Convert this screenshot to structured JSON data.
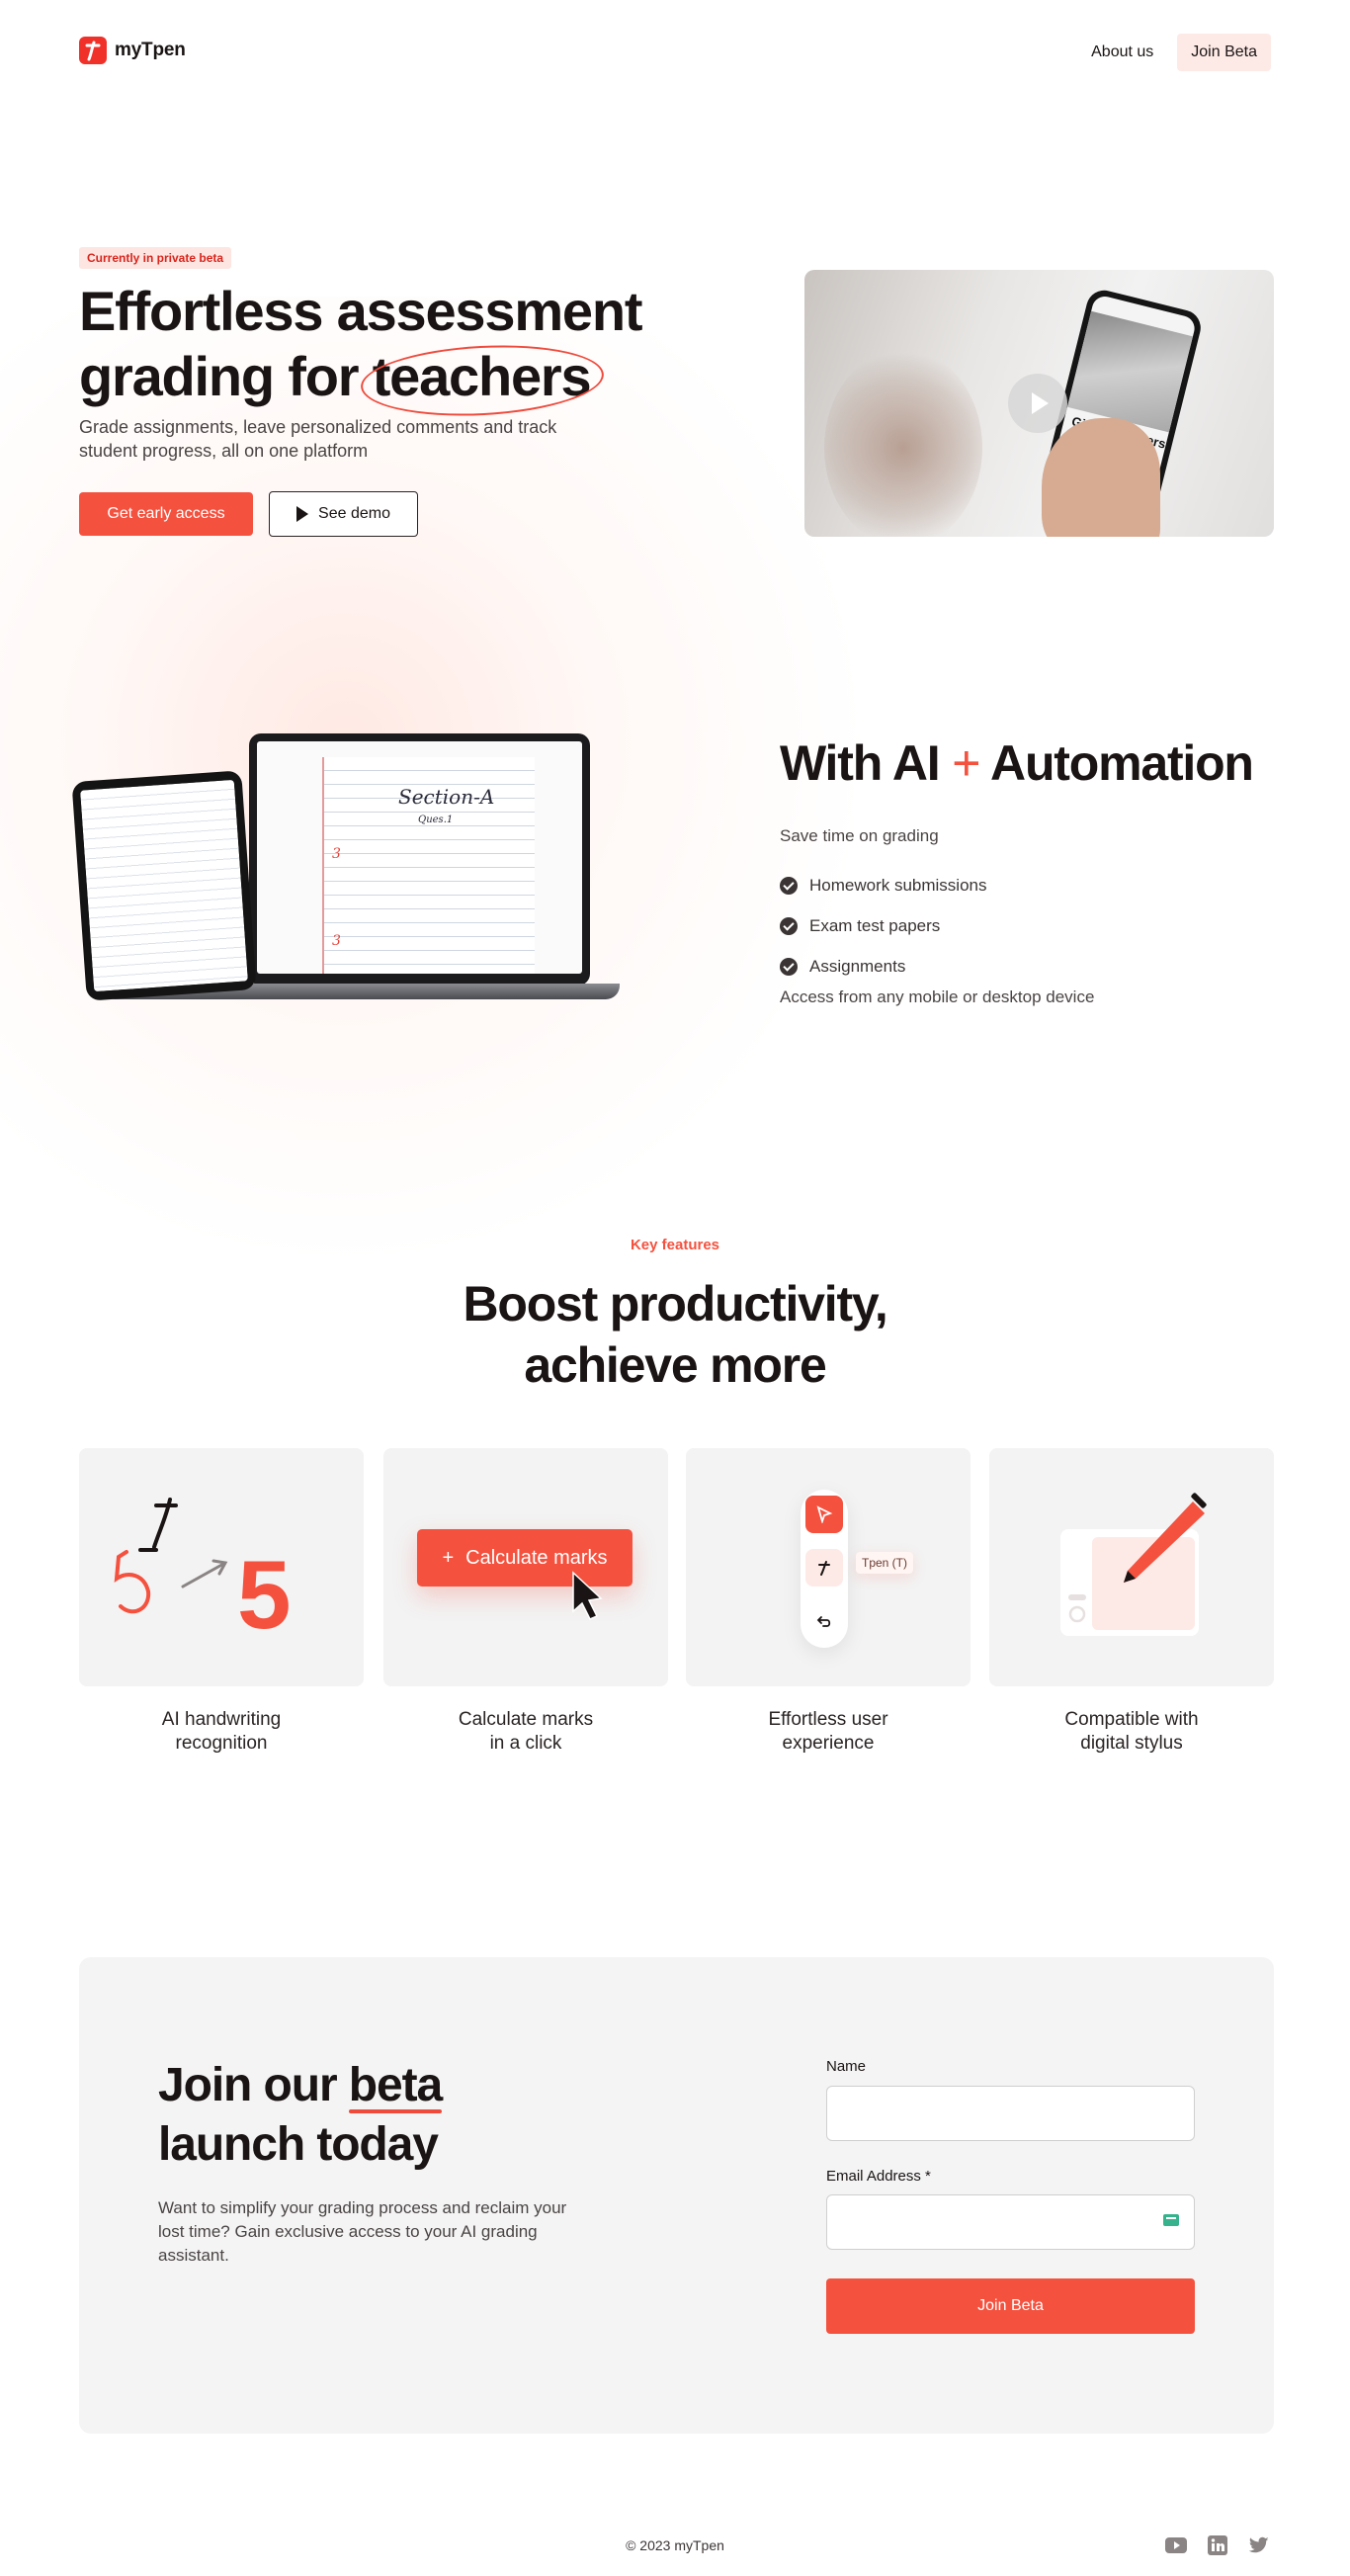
{
  "header": {
    "logo_text": "myTpen",
    "nav": {
      "about": "About us",
      "join": "Join Beta"
    }
  },
  "hero": {
    "badge": "Currently in private beta",
    "title_line1": "Effortless assessment",
    "title_line2_prefix": "grading for ",
    "title_highlight": "teachers",
    "subtitle": "Grade assignments, leave personalized comments and track student progress, all on one platform",
    "primary_cta": "Get early access",
    "secondary_cta": "See demo",
    "video_phone_text": "Giving teachers time back"
  },
  "ai_section": {
    "title_prefix": "With AI",
    "title_plus": "+",
    "title_suffix": "Automation",
    "lead": "Save time on grading",
    "items": [
      "Homework submissions",
      "Exam test papers",
      "Assignments"
    ],
    "footer": "Access from any mobile or desktop device",
    "paper_heading": "Section-A",
    "paper_sub": "Ques.1",
    "paper_marks": [
      "3",
      "3"
    ]
  },
  "features": {
    "label": "Key features",
    "title_line1": "Boost productivity,",
    "title_line2": "achieve more",
    "cards": [
      {
        "label_line1": "AI handwriting",
        "label_line2": "recognition",
        "digit": "5"
      },
      {
        "label_line1": "Calculate marks",
        "label_line2": "in a click",
        "button": "Calculate marks"
      },
      {
        "label_line1": "Effortless user",
        "label_line2": "experience",
        "tooltip": "Tpen (T)"
      },
      {
        "label_line1": "Compatible with",
        "label_line2": "digital stylus"
      }
    ]
  },
  "beta": {
    "title_prefix": "Join our ",
    "title_highlight": "beta",
    "title_line2": "launch today",
    "subtitle": "Want to simplify your grading process and reclaim your lost time? Gain exclusive access to your AI grading assistant.",
    "name_label": "Name",
    "name_value": "",
    "email_label": "Email Address *",
    "email_value": "",
    "submit": "Join Beta"
  },
  "footer": {
    "copyright": "© 2023 myTpen",
    "socials": [
      "youtube-icon",
      "linkedin-icon",
      "twitter-icon"
    ]
  },
  "colors": {
    "accent": "#f4513e",
    "text": "#1a1414",
    "card_bg": "#f3f3f3",
    "badge_bg": "#fde5e1"
  }
}
